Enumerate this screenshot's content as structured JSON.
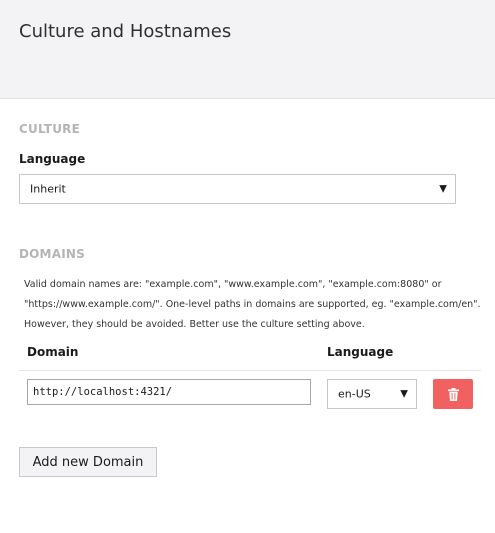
{
  "header": {
    "title": "Culture and Hostnames"
  },
  "culture": {
    "section_title": "CULTURE",
    "language_label": "Language",
    "language_value": "Inherit"
  },
  "domains": {
    "section_title": "DOMAINS",
    "help_lines": [
      "Valid domain names are: \"example.com\", \"www.example.com\", \"example.com:8080\" or",
      "\"https://www.example.com/\". One-level paths in domains are supported, eg. \"example.com/en\".",
      "However, they should be avoided. Better use the culture setting above."
    ],
    "columns": {
      "domain": "Domain",
      "language": "Language"
    },
    "rows": [
      {
        "domain": "http://localhost:4321/",
        "language": "en-US"
      }
    ],
    "add_label": "Add new Domain"
  },
  "icons": {
    "delete": "trash-icon",
    "caret": "chevron-down-icon"
  },
  "colors": {
    "delete": "#f0615f",
    "header_bg": "#f3f3f5",
    "section_title": "#b5b5b5"
  }
}
